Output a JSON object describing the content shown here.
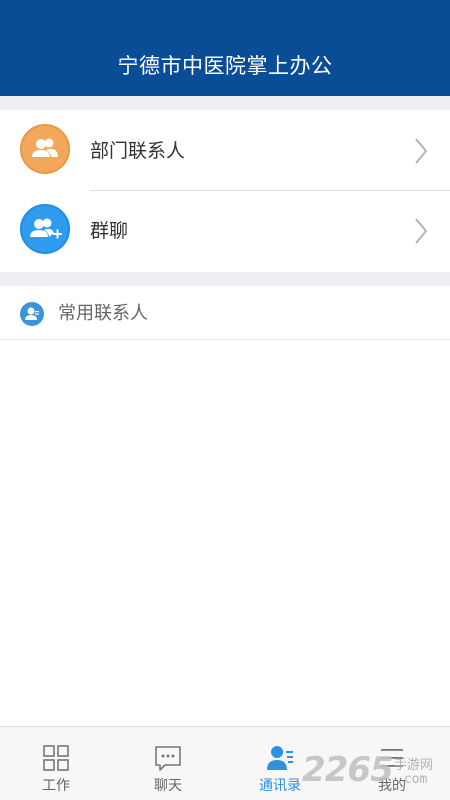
{
  "header": {
    "title": "宁德市中医院掌上办公"
  },
  "contacts": {
    "items": [
      {
        "label": "部门联系人",
        "icon": "group-icon",
        "color": "#f2a75a"
      },
      {
        "label": "群聊",
        "icon": "add-group-icon",
        "color": "#2f9cf0"
      }
    ]
  },
  "frequent": {
    "label": "常用联系人",
    "icon": "person-icon"
  },
  "tabbar": {
    "tabs": [
      {
        "label": "工作",
        "icon": "grid-icon",
        "active": false
      },
      {
        "label": "聊天",
        "icon": "chat-icon",
        "active": false
      },
      {
        "label": "通讯录",
        "icon": "contacts-icon",
        "active": true
      },
      {
        "label": "我的",
        "icon": "menu-icon",
        "active": false
      }
    ]
  },
  "watermark": {
    "brand": "2265",
    "suffix": "手游网",
    "domain": ".com"
  },
  "colors": {
    "header": "#0a4d97",
    "accent": "#2f8fe0"
  }
}
